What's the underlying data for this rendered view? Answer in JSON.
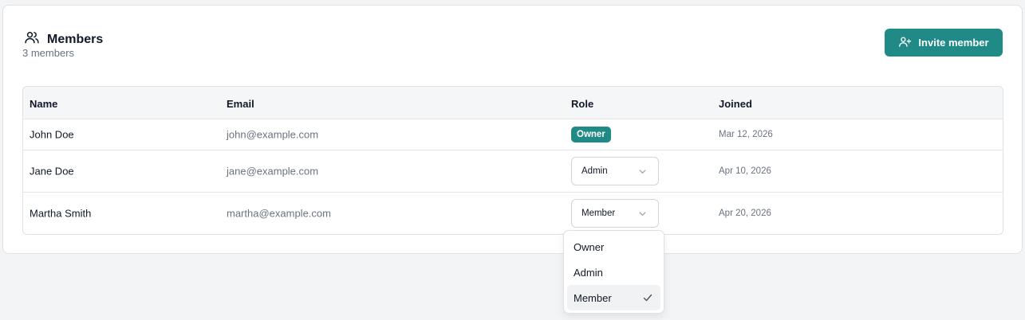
{
  "header": {
    "title": "Members",
    "subtitle": "3 members",
    "invite_label": "Invite member"
  },
  "table": {
    "columns": [
      "Name",
      "Email",
      "Role",
      "Joined"
    ],
    "rows": [
      {
        "name": "John Doe",
        "email": "john@example.com",
        "role": "Owner",
        "joined": "Mar 12, 2026"
      },
      {
        "name": "Jane Doe",
        "email": "jane@example.com",
        "role": "Admin",
        "joined": "Apr 10, 2026"
      },
      {
        "name": "Martha Smith",
        "email": "martha@example.com",
        "role": "Member",
        "joined": "Apr 20, 2026"
      }
    ]
  },
  "role_dropdown": {
    "options": [
      "Owner",
      "Admin",
      "Member"
    ],
    "selected": "Member"
  },
  "colors": {
    "accent": "#1f8a86",
    "background": "#f3f4f6"
  },
  "icons": [
    "users-icon",
    "user-plus-icon",
    "chevron-down-icon",
    "check-icon"
  ]
}
